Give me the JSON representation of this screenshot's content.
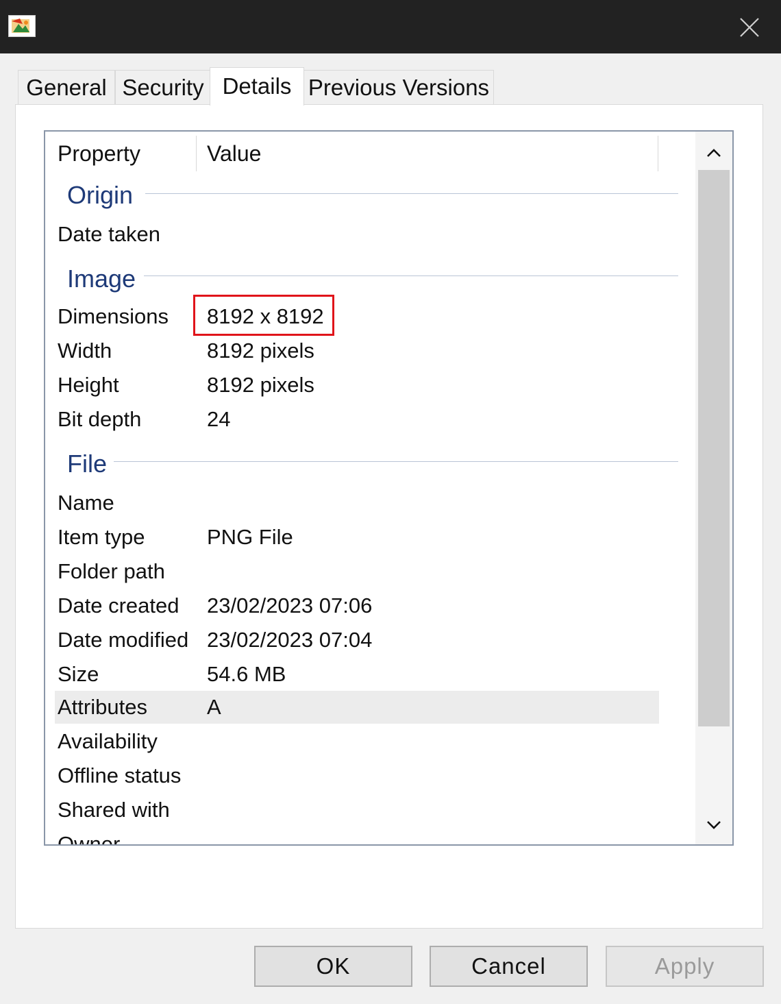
{
  "tabs": [
    {
      "label": "General"
    },
    {
      "label": "Security"
    },
    {
      "label": "Details"
    },
    {
      "label": "Previous Versions"
    }
  ],
  "list_header": {
    "property": "Property",
    "value": "Value"
  },
  "groups": {
    "origin": "Origin",
    "image": "Image",
    "file": "File"
  },
  "rows": [
    {
      "prop": "Date taken",
      "val": ""
    },
    {
      "prop": "Dimensions",
      "val": "8192 x 8192"
    },
    {
      "prop": "Width",
      "val": "8192 pixels"
    },
    {
      "prop": "Height",
      "val": "8192 pixels"
    },
    {
      "prop": "Bit depth",
      "val": "24"
    },
    {
      "prop": "Name",
      "val": ""
    },
    {
      "prop": "Item type",
      "val": "PNG File"
    },
    {
      "prop": "Folder path",
      "val": ""
    },
    {
      "prop": "Date created",
      "val": "23/02/2023 07:06"
    },
    {
      "prop": "Date modified",
      "val": "23/02/2023 07:04"
    },
    {
      "prop": "Size",
      "val": "54.6 MB"
    },
    {
      "prop": "Attributes",
      "val": "A"
    },
    {
      "prop": "Availability",
      "val": ""
    },
    {
      "prop": "Offline status",
      "val": ""
    },
    {
      "prop": "Shared with",
      "val": ""
    },
    {
      "prop": "Owner",
      "val": ""
    }
  ],
  "buttons": {
    "ok": "OK",
    "cancel": "Cancel",
    "apply": "Apply"
  },
  "colors": {
    "highlight_border": "#e0141a",
    "group_title": "#1e3a78",
    "titlebar": "#222222"
  },
  "icons": {
    "app": "image-file-icon",
    "close": "close-icon",
    "scroll_up": "chevron-up-icon",
    "scroll_down": "chevron-down-icon",
    "overlay_emojis": [
      "thumbs-up-emoji",
      "star-struck-emoji",
      "heart-eyes-emoji"
    ]
  }
}
